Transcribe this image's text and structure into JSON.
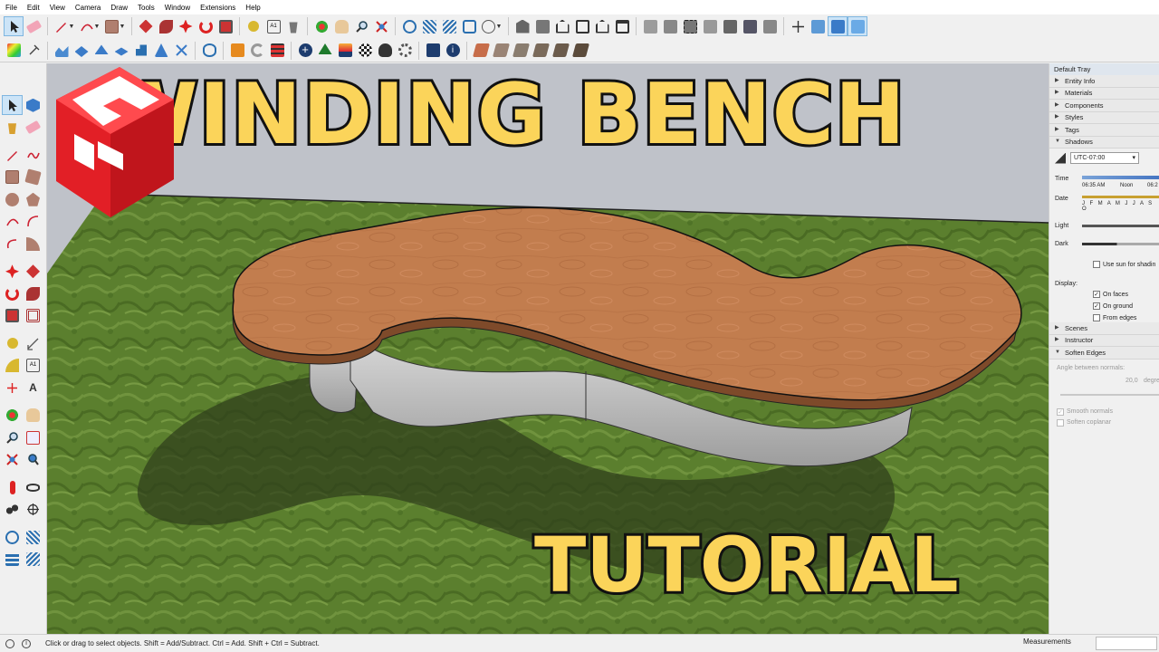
{
  "menu": [
    "File",
    "Edit",
    "View",
    "Camera",
    "Draw",
    "Tools",
    "Window",
    "Extensions",
    "Help"
  ],
  "thumbnail": {
    "title": "WINDING BENCH",
    "subtitle": "TUTORIAL"
  },
  "tray": {
    "title": "Default Tray",
    "sections_top": [
      "Entity Info",
      "Materials",
      "Components",
      "Styles",
      "Tags"
    ],
    "shadows": {
      "header": "Shadows",
      "timezone": "UTC-07:00",
      "time_label": "Time",
      "time_start": "06:35 AM",
      "time_mid": "Noon",
      "time_end": "06:2",
      "date_label": "Date",
      "months": "J F M A M J J A S O",
      "light_label": "Light",
      "dark_label": "Dark",
      "use_sun": "Use sun for shadin",
      "display_label": "Display:",
      "on_faces": "On faces",
      "on_ground": "On ground",
      "from_edges": "From edges",
      "on_faces_checked": true,
      "on_ground_checked": true,
      "from_edges_checked": false,
      "use_sun_checked": false
    },
    "sections_bottom": [
      "Scenes",
      "Instructor"
    ],
    "soften": {
      "header": "Soften Edges",
      "angle_label": "Angle between normals:",
      "angle_value": "20,0",
      "angle_unit": "degre",
      "smooth_normals": "Smooth normals",
      "soften_coplanar": "Soften coplanar"
    }
  },
  "status": {
    "hint": "Click or drag to select objects. Shift = Add/Subtract. Ctrl = Add. Shift + Ctrl = Subtract.",
    "measurements_label": "Measurements"
  },
  "colors": {
    "title_fill": "#fbd45a",
    "title_stroke": "#111111",
    "wood": "#c27d4e",
    "grass": "#5b7f2e",
    "sky": "#bfc2c9",
    "logo_red": "#e21f26"
  }
}
